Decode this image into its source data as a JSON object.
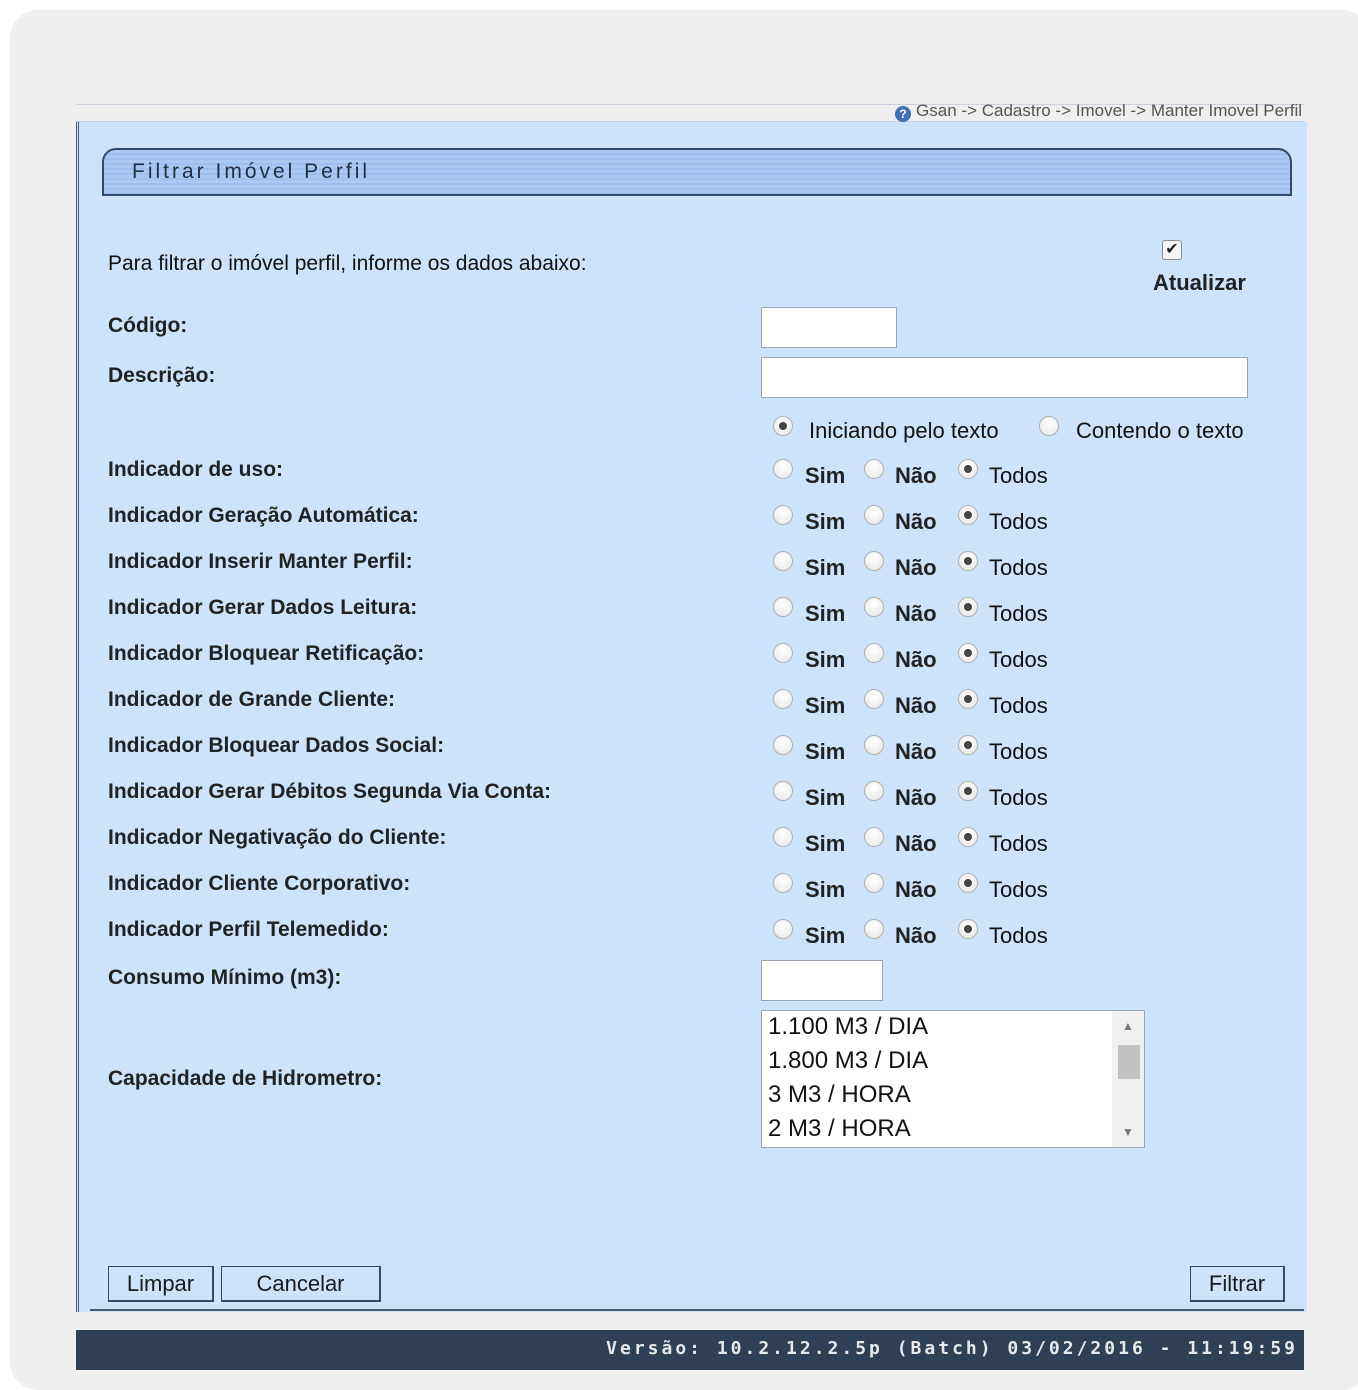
{
  "breadcrumb": "Gsan -> Cadastro -> Imovel -> Manter Imovel Perfil",
  "title": "Filtrar Imóvel Perfil",
  "intro": "Para filtrar o imóvel perfil, informe os dados abaixo:",
  "atualizar": {
    "label": "Atualizar",
    "checked": true
  },
  "fields": {
    "codigo": {
      "label": "Código:",
      "value": ""
    },
    "descricao": {
      "label": "Descrição:",
      "value": ""
    },
    "consumo": {
      "label": "Consumo Mínimo (m3):",
      "value": ""
    },
    "capacidade": {
      "label": "Capacidade de Hidrometro:"
    }
  },
  "match_options": {
    "iniciando": "Iniciando pelo texto",
    "contendo": "Contendo o texto",
    "selected": "iniciando"
  },
  "choice_labels": {
    "sim": "Sim",
    "nao": "Não",
    "todos": "Todos"
  },
  "indicators": [
    {
      "label": "Indicador de uso:",
      "selected": "todos"
    },
    {
      "label": "Indicador Geração Automática:",
      "selected": "todos"
    },
    {
      "label": "Indicador Inserir Manter Perfil:",
      "selected": "todos"
    },
    {
      "label": "Indicador Gerar Dados Leitura:",
      "selected": "todos"
    },
    {
      "label": "Indicador Bloquear Retificação:",
      "selected": "todos"
    },
    {
      "label": "Indicador de Grande Cliente:",
      "selected": "todos"
    },
    {
      "label": "Indicador Bloquear Dados Social:",
      "selected": "todos"
    },
    {
      "label": "Indicador Gerar Débitos Segunda Via Conta:",
      "selected": "todos"
    },
    {
      "label": "Indicador Negativação do Cliente:",
      "selected": "todos"
    },
    {
      "label": "Indicador Cliente Corporativo:",
      "selected": "todos"
    },
    {
      "label": "Indicador Perfil Telemedido:",
      "selected": "todos"
    }
  ],
  "capacidade_options": [
    "1.100 M3 / DIA",
    "1.800 M3 / DIA",
    "3 M3 / HORA",
    "2 M3 / HORA"
  ],
  "buttons": {
    "limpar": "Limpar",
    "cancelar": "Cancelar",
    "filtrar": "Filtrar"
  },
  "footer": "Versão: 10.2.12.2.5p (Batch) 03/02/2016 - 11:19:59"
}
